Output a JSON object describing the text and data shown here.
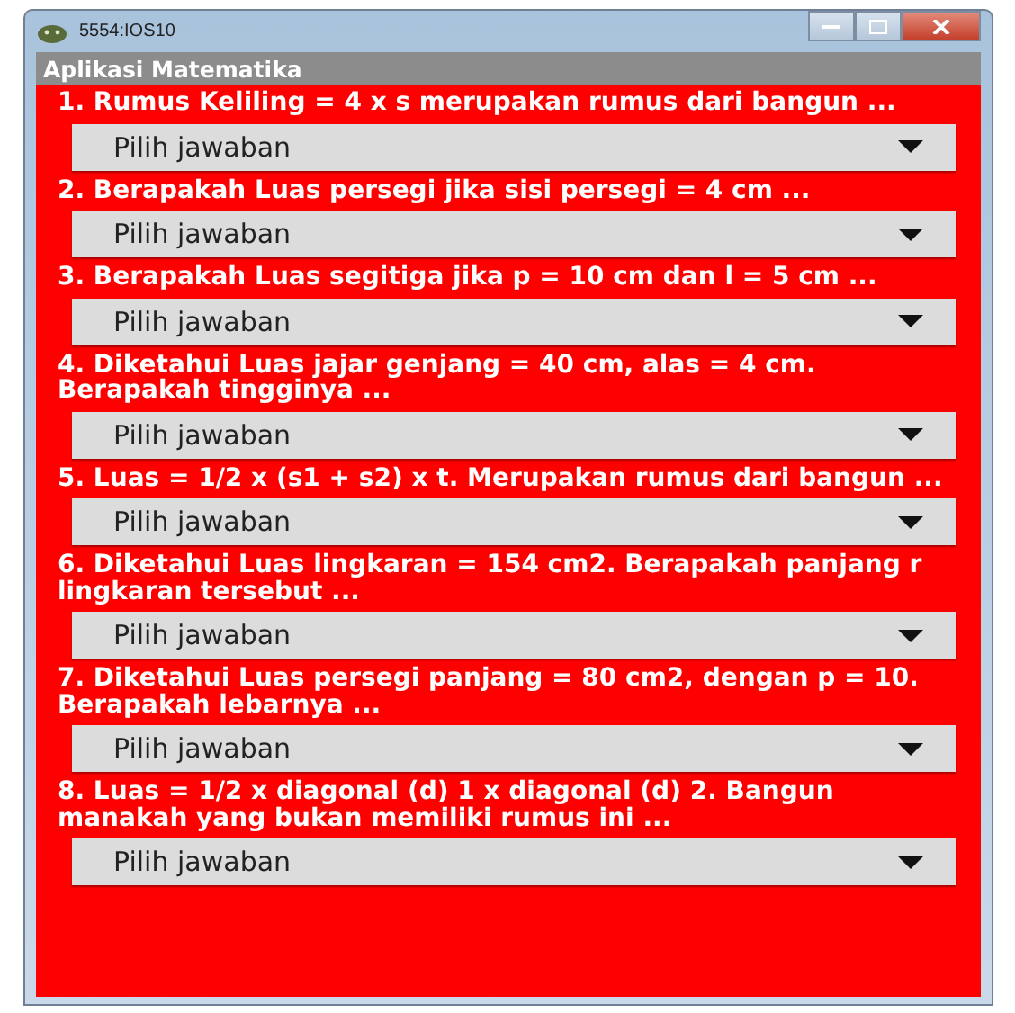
{
  "window": {
    "title": "5554:IOS10"
  },
  "app_bar": {
    "title": "Aplikasi Matematika"
  },
  "questions": [
    {
      "text": "1. Rumus Keliling = 4 x s merupakan rumus dari bangun ...",
      "dropdown": "Pilih jawaban"
    },
    {
      "text": "2. Berapakah Luas persegi jika sisi persegi = 4 cm ...",
      "dropdown": "Pilih jawaban"
    },
    {
      "text": "3. Berapakah Luas segitiga jika p = 10 cm dan l = 5 cm ...",
      "dropdown": "Pilih jawaban"
    },
    {
      "text": "4. Diketahui Luas jajar genjang = 40 cm, alas = 4 cm. Berapakah tingginya ...",
      "dropdown": "Pilih jawaban"
    },
    {
      "text": "5. Luas = 1/2 x (s1 + s2) x t. Merupakan rumus dari bangun ...",
      "dropdown": "Pilih jawaban"
    },
    {
      "text": "6. Diketahui Luas lingkaran = 154 cm2. Berapakah panjang r lingkaran tersebut ...",
      "dropdown": "Pilih jawaban"
    },
    {
      "text": "7. Diketahui Luas persegi panjang = 80 cm2, dengan p = 10. Berapakah lebarnya ...",
      "dropdown": "Pilih jawaban"
    },
    {
      "text": "8. Luas = 1/2 x diagonal (d) 1 x diagonal (d) 2. Bangun manakah yang bukan memiliki rumus ini ...",
      "dropdown": "Pilih jawaban"
    }
  ]
}
